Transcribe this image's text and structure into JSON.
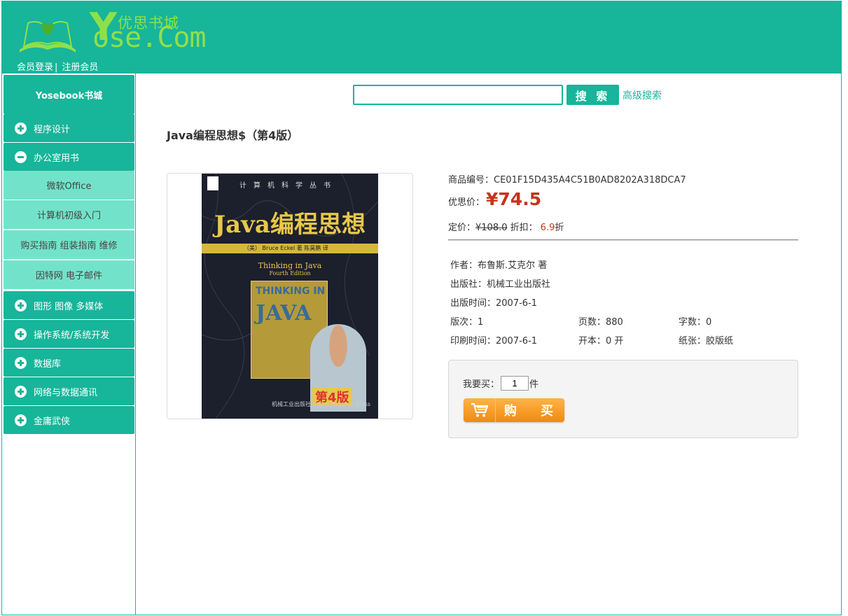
{
  "header": {
    "logo_cn": "优思书城",
    "logo_en": "ose.Com",
    "logo_y": "Y",
    "login_label": "会员登录",
    "login_sep": "|",
    "register_label": "注册会员"
  },
  "sidebar": {
    "title": "Yosebook书城",
    "items": [
      {
        "label": "程序设计",
        "type": "category",
        "expanded": false
      },
      {
        "label": "办公室用书",
        "type": "category",
        "expanded": true
      },
      {
        "label": "微软Office",
        "type": "sub"
      },
      {
        "label": "计算机初级入门",
        "type": "sub"
      },
      {
        "label": "购买指南 组装指南 维修",
        "type": "sub"
      },
      {
        "label": "因特网 电子邮件",
        "type": "sub"
      },
      {
        "label": "图形 图像 多媒体",
        "type": "category",
        "expanded": false
      },
      {
        "label": "操作系统/系统开发",
        "type": "category",
        "expanded": false
      },
      {
        "label": "数据库",
        "type": "category",
        "expanded": false
      },
      {
        "label": "网络与数据通讯",
        "type": "category",
        "expanded": false
      },
      {
        "label": "金庸武侠",
        "type": "category",
        "expanded": false
      }
    ]
  },
  "search": {
    "value": "",
    "button_label": "搜 索",
    "advanced_label": "高级搜索"
  },
  "product": {
    "title": "Java编程思想$（第4版）",
    "code_label": "商品编号：",
    "code": "CE01F15D435A4C51B0AD8202A318DCA7",
    "price_label": "优思价：",
    "price": "¥74.5",
    "list_label": "定价：",
    "list_price": "¥108.0",
    "discount_label": "折扣：",
    "discount_value": "6.9",
    "discount_unit": "折",
    "author": "作者：布鲁斯.艾克尔 著",
    "publisher": "出版社：机械工业出版社",
    "pub_date": "出版时间：2007-6-1",
    "edition": "版次：1",
    "pages": "页数：880",
    "words": "字数：0",
    "print_date": "印刷时间：2007-6-1",
    "format": "开本：0 开",
    "paper": "纸张：胶版纸",
    "cover": {
      "series": "计算机科学丛书",
      "title": "Java编程思想",
      "authors": "（美） Bruce Eckel 著    陈昊鹏 译",
      "english": "Thinking in Java",
      "english_edition": "Fourth Edition",
      "inner_top": "THINKING IN",
      "inner_java": "JAVA",
      "edition": "第4版",
      "publisher": "机械工业出版社 China Machine Press"
    }
  },
  "buy": {
    "want_label": "我要买：",
    "quantity": "1",
    "unit": "件",
    "button_label": "购 买"
  },
  "colors": {
    "brand": "#17b59a",
    "sub_bg": "#72e3ca",
    "price": "#c5341d",
    "buy_button": "#f08a12"
  }
}
